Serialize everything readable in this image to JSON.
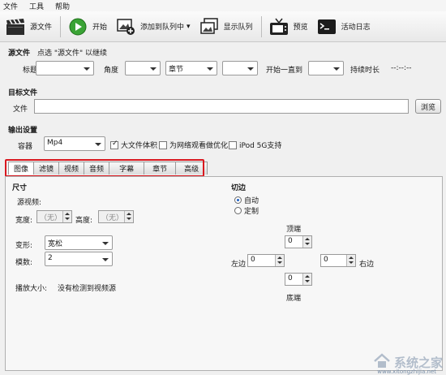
{
  "menu": [
    "文件",
    "工具",
    "帮助"
  ],
  "toolbar": {
    "source": "源文件",
    "start": "开始",
    "add_queue": "添加到队列中",
    "show_queue": "显示队列",
    "preview": "预览",
    "activity_log": "活动日志"
  },
  "source": {
    "section": "源文件",
    "hint": "点选 \"源文件\" 以继续",
    "title_label": "标题",
    "angle_label": "角度",
    "chapter_value": "章节",
    "start_until": "开始一直到",
    "duration_label": "持续时长",
    "duration_value": "--:--:--"
  },
  "dest": {
    "section": "目标文件",
    "file_label": "文件",
    "browse": "浏览"
  },
  "output": {
    "section": "输出设置",
    "container_label": "容器",
    "container_value": "Mp4",
    "large_file": "大文件体积",
    "web_optimized": "为网络观看做优化",
    "ipod": "iPod 5G支持"
  },
  "tabs": [
    "图像",
    "滤镜",
    "视频",
    "音频",
    "字幕",
    "章节",
    "高级"
  ],
  "picture": {
    "size_title": "尺寸",
    "source_label": "源视频:",
    "width_label": "宽度:",
    "width_value": "（无）",
    "height_label": "高度:",
    "height_value": "（无）",
    "anamorphic_label": "变形:",
    "anamorphic_value": "宽松",
    "modulus_label": "模数:",
    "modulus_value": "2",
    "display_size_label": "播放大小:",
    "display_size_value": "没有检测到视频源",
    "crop_title": "切边",
    "crop_auto": "自动",
    "crop_custom": "定制",
    "top_label": "顶端",
    "bottom_label": "底端",
    "left_label": "左边",
    "right_label": "右边",
    "top_value": "0",
    "bottom_value": "0",
    "left_value": "0",
    "right_value": "0"
  },
  "watermark": {
    "text": "系统之家",
    "url": "www.xitongzhijia.net"
  }
}
